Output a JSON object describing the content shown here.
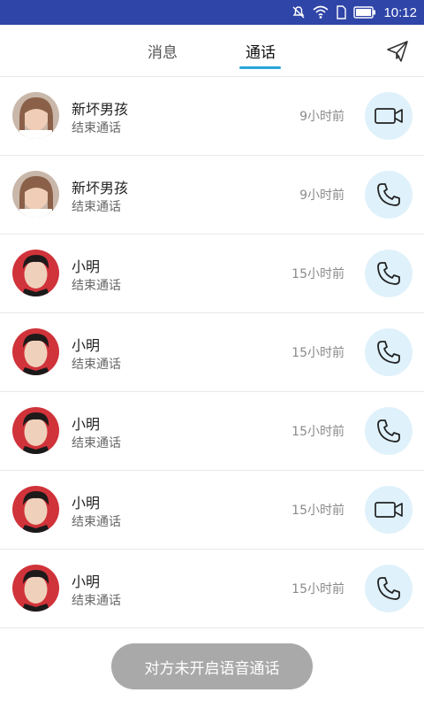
{
  "status": {
    "time": "10:12"
  },
  "tabs": [
    {
      "label": "消息",
      "active": false
    },
    {
      "label": "通话",
      "active": true
    }
  ],
  "colors": {
    "status_bar": "#2f45a8",
    "accent": "#2aa6d8",
    "call_button_bg": "#dff1fb",
    "toast_bg": "#a9a9a9"
  },
  "calls": [
    {
      "name": "新坏男孩",
      "status": "结束通话",
      "time": "9小时前",
      "type": "video",
      "avatar": "girl"
    },
    {
      "name": "新坏男孩",
      "status": "结束通话",
      "time": "9小时前",
      "type": "voice",
      "avatar": "girl"
    },
    {
      "name": "小明",
      "status": "结束通话",
      "time": "15小时前",
      "type": "voice",
      "avatar": "man"
    },
    {
      "name": "小明",
      "status": "结束通话",
      "time": "15小时前",
      "type": "voice",
      "avatar": "man"
    },
    {
      "name": "小明",
      "status": "结束通话",
      "time": "15小时前",
      "type": "voice",
      "avatar": "man"
    },
    {
      "name": "小明",
      "status": "结束通话",
      "time": "15小时前",
      "type": "video",
      "avatar": "man"
    },
    {
      "name": "小明",
      "status": "结束通话",
      "time": "15小时前",
      "type": "voice",
      "avatar": "man"
    }
  ],
  "toast": "对方未开启语音通话"
}
